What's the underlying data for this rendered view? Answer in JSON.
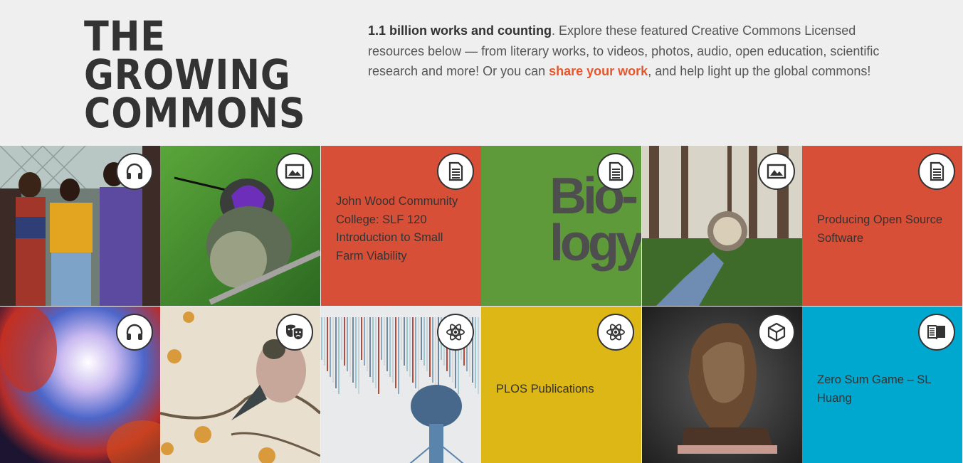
{
  "hero": {
    "title_lines": [
      "THE",
      "GROWING",
      "COMMONS"
    ],
    "intro_bold": "1.1 billion works and counting",
    "intro_text_1": ". Explore these featured Creative Commons Licensed resources below — from literary works, to videos, photos, audio, open education, scientific research and more! Or you can ",
    "link_text": "share your work",
    "intro_text_2": ", and help light up the global commons!"
  },
  "colors": {
    "accent_link": "#e4572e",
    "tile_red": "#d84f38",
    "tile_green": "#5f9a3a",
    "tile_yellow": "#dcb715",
    "tile_blue": "#00a8d0"
  },
  "tiles": [
    {
      "type_icon": "headphones-icon",
      "label": ""
    },
    {
      "type_icon": "image-icon",
      "label": ""
    },
    {
      "type_icon": "document-icon",
      "label": "John Wood Community College: SLF 120 Introduction to Small Farm Viability"
    },
    {
      "type_icon": "document-icon",
      "label": "",
      "cover_text": [
        "Bio-",
        "logy"
      ]
    },
    {
      "type_icon": "image-icon",
      "label": ""
    },
    {
      "type_icon": "document-icon",
      "label": "Producing Open Source Software"
    },
    {
      "type_icon": "headphones-icon",
      "label": ""
    },
    {
      "type_icon": "theater-masks-icon",
      "label": ""
    },
    {
      "type_icon": "atom-icon",
      "label": ""
    },
    {
      "type_icon": "atom-icon",
      "label": "PLOS Publications"
    },
    {
      "type_icon": "cube-icon",
      "label": ""
    },
    {
      "type_icon": "book-icon",
      "label": "Zero Sum Game – SL Huang"
    }
  ]
}
